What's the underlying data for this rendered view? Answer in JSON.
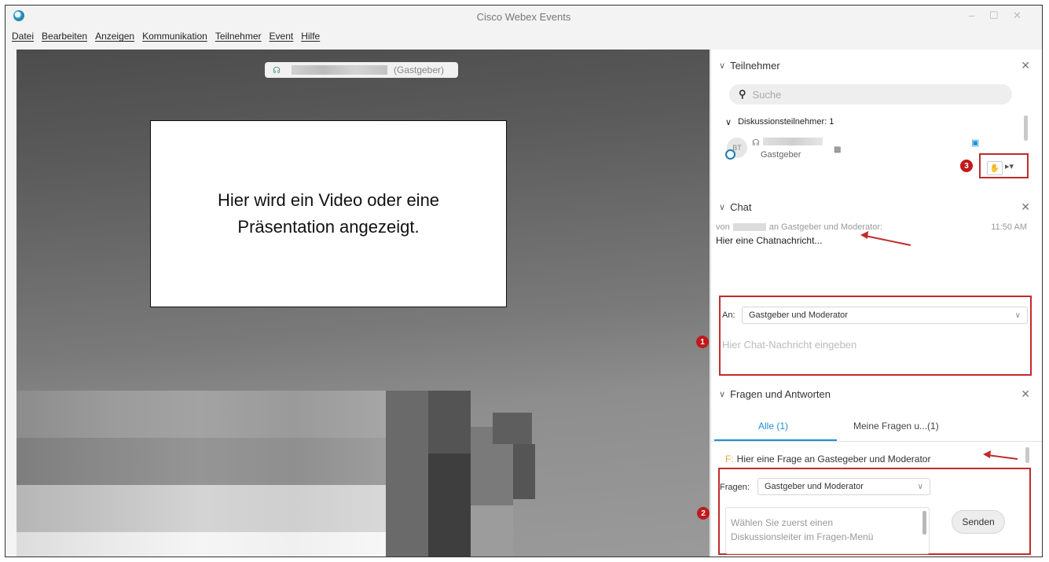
{
  "window": {
    "title": "Cisco Webex Events",
    "minimize": "–",
    "maximize": "☐",
    "close": "✕"
  },
  "menu": [
    "Datei",
    "Bearbeiten",
    "Anzeigen",
    "Kommunikation",
    "Teilnehmer",
    "Event",
    "Hilfe"
  ],
  "stage": {
    "host_role": "(Gastgeber)",
    "presentation_text_line1": "Hier wird ein Video oder eine",
    "presentation_text_line2": "Präsentation angezeigt."
  },
  "participants": {
    "title": "Teilnehmer",
    "search_placeholder": "Suche",
    "group_label": "Diskussionsteilnehmer: 1",
    "member_role": "Gastgeber",
    "avatar_initials": "BT",
    "marker": "3"
  },
  "chat": {
    "title": "Chat",
    "from_prefix": "von",
    "to_suffix": "an Gastgeber und Moderator:",
    "time": "11:50 AM",
    "message": "Hier eine Chatnachricht...",
    "to_label": "An:",
    "to_value": "Gastgeber und Moderator",
    "input_placeholder": "Hier Chat-Nachricht eingeben",
    "marker": "1"
  },
  "qa": {
    "title": "Fragen und Antworten",
    "tab_all": "Alle (1)",
    "tab_mine": "Meine Fragen u...(1)",
    "question_prefix": "F:",
    "question_text": "Hier eine Frage an Gastegeber und Moderator",
    "ask_label": "Fragen:",
    "ask_value": "Gastgeber und Moderator",
    "input_text_line1": "Wählen Sie zuerst einen",
    "input_text_line2": "Diskussionsleiter im Fragen-Menü",
    "send_label": "Senden",
    "marker": "2"
  },
  "colors": {
    "accent_blue": "#1d8fd6",
    "annotation_red": "#c22b2b"
  }
}
